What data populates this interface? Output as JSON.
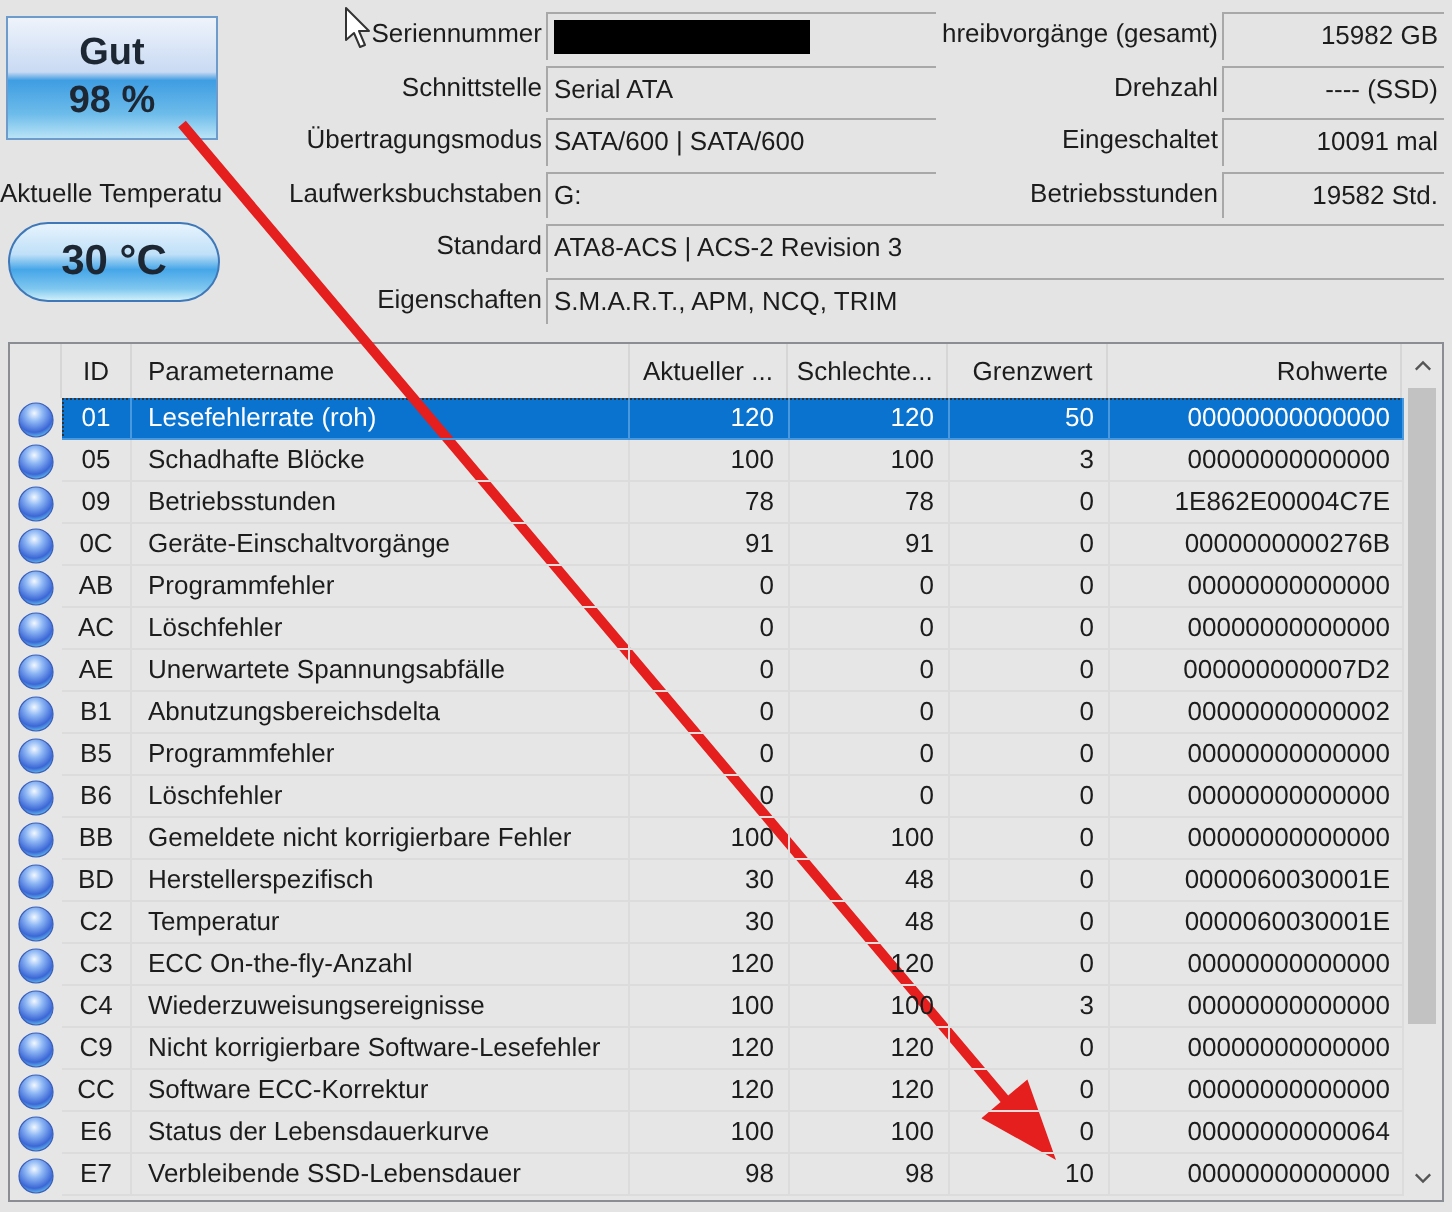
{
  "health": {
    "status": "Gut",
    "percent": "98 %"
  },
  "temperature": {
    "label": "Aktuelle Temperatu",
    "value": "30 °C"
  },
  "info": [
    {
      "label": "Seriennummer",
      "redacted": true,
      "side": {
        "label": "hreibvorgänge (gesamt)",
        "value": "15982 GB"
      }
    },
    {
      "label": "Schnittstelle",
      "redacted": false,
      "value": "Serial ATA",
      "side": {
        "label": "Drehzahl",
        "value": "---- (SSD)"
      }
    },
    {
      "label": "Übertragungsmodus",
      "redacted": false,
      "value": "SATA/600 | SATA/600",
      "side": {
        "label": "Eingeschaltet",
        "value": "10091 mal"
      }
    },
    {
      "label": "Laufwerksbuchstaben",
      "redacted": false,
      "value": "G:",
      "side": {
        "label": "Betriebsstunden",
        "value": "19582 Std."
      }
    },
    {
      "label": "Standard",
      "redacted": false,
      "value": "ATA8-ACS | ACS-2 Revision 3"
    },
    {
      "label": "Eigenschaften",
      "redacted": false,
      "value": "S.M.A.R.T., APM, NCQ, TRIM"
    }
  ],
  "table": {
    "columns": [
      "ID",
      "Parametername",
      "Aktueller ...",
      "Schlechte...",
      "Grenzwert",
      "Rohwerte"
    ],
    "rows": [
      {
        "cells": [
          "01",
          "Lesefehlerrate (roh)",
          "120",
          "120",
          "50",
          "00000000000000"
        ],
        "selected": true
      },
      {
        "cells": [
          "05",
          "Schadhafte Blöcke",
          "100",
          "100",
          "3",
          "00000000000000"
        ],
        "selected": false
      },
      {
        "cells": [
          "09",
          "Betriebsstunden",
          "78",
          "78",
          "0",
          "1E862E00004C7E"
        ],
        "selected": false
      },
      {
        "cells": [
          "0C",
          "Geräte-Einschaltvorgänge",
          "91",
          "91",
          "0",
          "0000000000276B"
        ],
        "selected": false
      },
      {
        "cells": [
          "AB",
          "Programmfehler",
          "0",
          "0",
          "0",
          "00000000000000"
        ],
        "selected": false
      },
      {
        "cells": [
          "AC",
          "Löschfehler",
          "0",
          "0",
          "0",
          "00000000000000"
        ],
        "selected": false
      },
      {
        "cells": [
          "AE",
          "Unerwartete Spannungsabfälle",
          "0",
          "0",
          "0",
          "000000000007D2"
        ],
        "selected": false
      },
      {
        "cells": [
          "B1",
          "Abnutzungsbereichsdelta",
          "0",
          "0",
          "0",
          "00000000000002"
        ],
        "selected": false
      },
      {
        "cells": [
          "B5",
          "Programmfehler",
          "0",
          "0",
          "0",
          "00000000000000"
        ],
        "selected": false
      },
      {
        "cells": [
          "B6",
          "Löschfehler",
          "0",
          "0",
          "0",
          "00000000000000"
        ],
        "selected": false
      },
      {
        "cells": [
          "BB",
          "Gemeldete nicht korrigierbare Fehler",
          "100",
          "100",
          "0",
          "00000000000000"
        ],
        "selected": false
      },
      {
        "cells": [
          "BD",
          "Herstellerspezifisch",
          "30",
          "48",
          "0",
          "0000060030001E"
        ],
        "selected": false
      },
      {
        "cells": [
          "C2",
          "Temperatur",
          "30",
          "48",
          "0",
          "0000060030001E"
        ],
        "selected": false
      },
      {
        "cells": [
          "C3",
          "ECC On-the-fly-Anzahl",
          "120",
          "120",
          "0",
          "00000000000000"
        ],
        "selected": false
      },
      {
        "cells": [
          "C4",
          "Wiederzuweisungsereignisse",
          "100",
          "100",
          "3",
          "00000000000000"
        ],
        "selected": false
      },
      {
        "cells": [
          "C9",
          "Nicht korrigierbare Software-Lesefehler",
          "120",
          "120",
          "0",
          "00000000000000"
        ],
        "selected": false
      },
      {
        "cells": [
          "CC",
          "Software ECC-Korrektur",
          "120",
          "120",
          "0",
          "00000000000000"
        ],
        "selected": false
      },
      {
        "cells": [
          "E6",
          "Status der Lebensdauerkurve",
          "100",
          "100",
          "0",
          "00000000000064"
        ],
        "selected": false
      },
      {
        "cells": [
          "E7",
          "Verbleibende SSD-Lebensdauer",
          "98",
          "98",
          "10",
          "00000000000000"
        ],
        "selected": false
      }
    ]
  }
}
